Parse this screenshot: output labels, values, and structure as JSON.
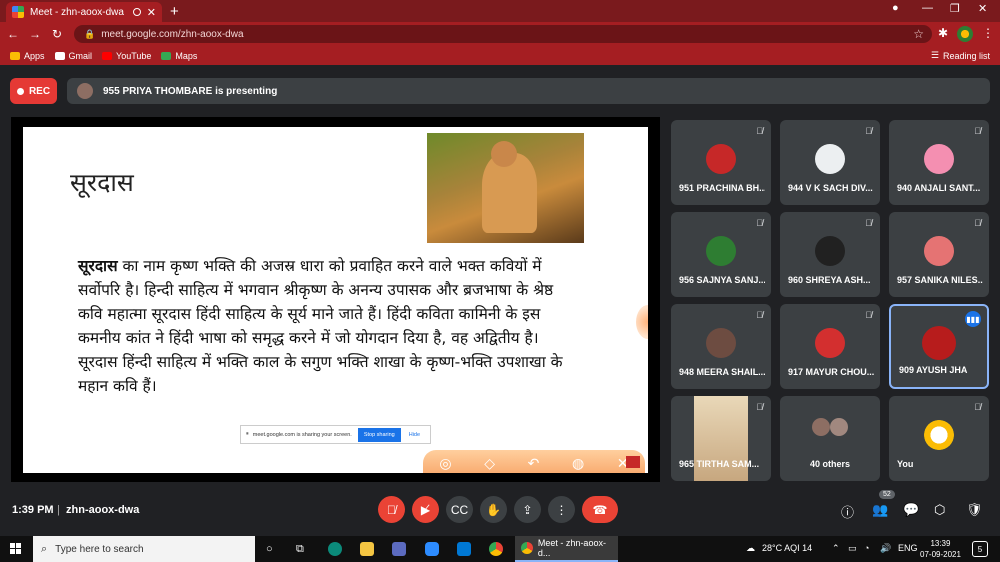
{
  "browser": {
    "tab_title": "Meet - zhn-aoox-dwa",
    "url": "meet.google.com/zhn-aoox-dwa",
    "bookmarks": [
      "Apps",
      "Gmail",
      "YouTube",
      "Maps"
    ],
    "reading_list": "Reading list"
  },
  "meet": {
    "rec_label": "REC",
    "presenting_text": "955 PRIYA THOMBARE is presenting",
    "slide": {
      "title": "सूरदास",
      "body_bold": "सूरदास",
      "body_text": " का नाम कृष्ण भक्ति की अजस्र धारा को प्रवाहित करने वाले भक्त कवियों में सर्वोपरि है। हिन्दी साहित्य में भगवान श्रीकृष्ण के अनन्य उपासक और ब्रजभाषा के श्रेष्ठ कवि महात्मा सूरदास हिंदी साहित्य के सूर्य माने जाते हैं। हिंदी कविता कामिनी के इस कमनीय कांत ने हिंदी भाषा को समृद्ध करने में जो योगदान दिया है, वह अद्वितीय है। सूरदास हिंन्दी साहित्य में भक्ति काल के सगुण भक्ति शाखा के कृष्ण-भक्ति उपशाखा के महान कवि हैं।"
    },
    "share_bar": {
      "text": "meet.google.com is sharing your screen.",
      "stop": "Stop sharing",
      "hide": "Hide"
    },
    "participants": [
      {
        "name": "951 PRACHINA BH...",
        "color": "#c62828"
      },
      {
        "name": "944 V K SACH DIV...",
        "color": "#eceff1"
      },
      {
        "name": "940 ANJALI SANT...",
        "color": "#f48fb1"
      },
      {
        "name": "956 SAJNYA SANJ...",
        "color": "#2e7d32"
      },
      {
        "name": "960 SHREYA ASH...",
        "color": "#212121"
      },
      {
        "name": "957 SANIKA NILES...",
        "color": "#e57373"
      },
      {
        "name": "948 MEERA SHAIL...",
        "color": "#6d4c41"
      },
      {
        "name": "917 MAYUR CHOU...",
        "color": "#d32f2f"
      },
      {
        "name": "909 AYUSH JHA",
        "color": "#b71c1c"
      },
      {
        "name": "965 TIRTHA SAM...",
        "color": "#e0c9a6"
      },
      {
        "name": "40 others",
        "color": "#5f6368"
      },
      {
        "name": "You",
        "color": "#fbbc04"
      }
    ],
    "bottom": {
      "time": "1:39 PM",
      "code": "zhn-aoox-dwa",
      "people_count": "52"
    }
  },
  "taskbar": {
    "search_placeholder": "Type here to search",
    "active_app": "Meet - zhn-aoox-d...",
    "weather": "28°C  AQI 14",
    "lang": "ENG",
    "time": "13:39",
    "date": "07-09-2021",
    "notifications": "5"
  }
}
